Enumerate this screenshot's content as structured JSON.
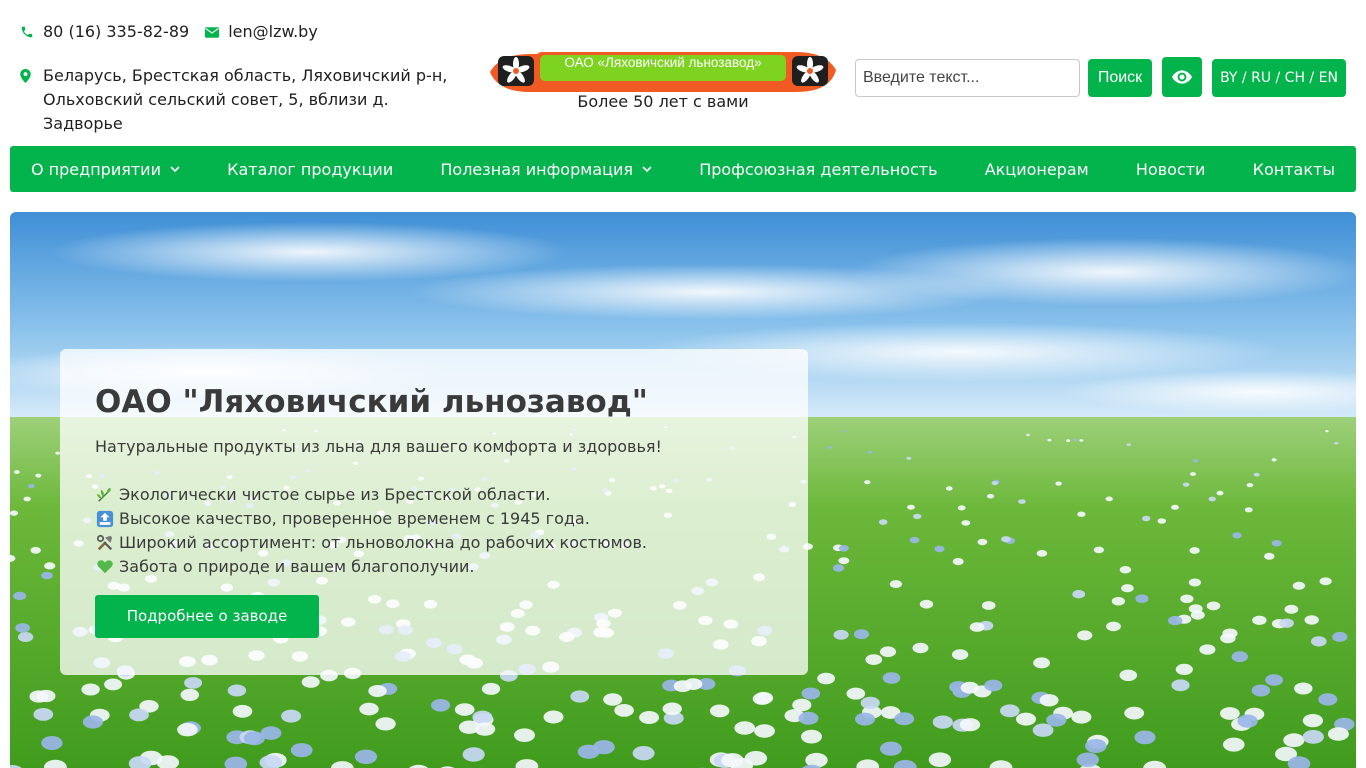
{
  "contacts": {
    "phone": "80 (16) 335-82-89",
    "email": "len@lzw.by",
    "address": "Беларусь, Брестская область, Ляховичский р-н, Ольховский сельский совет, 5, вблизи д. Задворье"
  },
  "logo": {
    "text": "ОАО «Ляховичский льнозавод»",
    "tagline": "Более 50 лет с вами"
  },
  "search": {
    "placeholder": "Введите текст...",
    "button_label": "Поиск"
  },
  "accessibility": {
    "icon": "eye-icon"
  },
  "language": {
    "label": "BY / RU / CH / EN"
  },
  "nav": {
    "items": [
      {
        "label": "О предприятии",
        "dropdown": true
      },
      {
        "label": "Каталог продукции",
        "dropdown": false
      },
      {
        "label": "Полезная информация",
        "dropdown": true
      },
      {
        "label": "Профсоюзная деятельность",
        "dropdown": false
      },
      {
        "label": "Акционерам",
        "dropdown": false
      },
      {
        "label": "Новости",
        "dropdown": false
      },
      {
        "label": "Контакты",
        "dropdown": false
      }
    ]
  },
  "hero": {
    "title": "ОАО \"Ляховичский льнозавод\"",
    "subtitle": "Натуральные продукты из льна для вашего комфорта и здоровья!",
    "bullets": [
      {
        "icon": "herb-icon",
        "text": "Экологически чистое сырье из Брестской области."
      },
      {
        "icon": "top-arrow-icon",
        "text": "Высокое качество, проверенное временем с 1945 года."
      },
      {
        "icon": "tools-icon",
        "text": "Широкий ассортимент: от льноволокна до рабочих костюмов."
      },
      {
        "icon": "green-heart-icon",
        "text": "Забота о природе и вашем благополучии."
      }
    ],
    "cta_label": "Подробнее о заводе"
  },
  "colors": {
    "brand_green": "#03b34c",
    "ribbon_orange": "#f15a22",
    "ribbon_green": "#7ed321"
  }
}
